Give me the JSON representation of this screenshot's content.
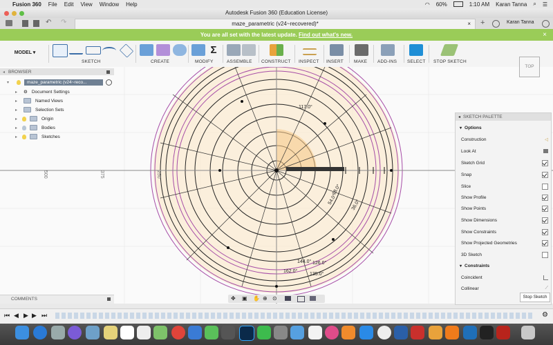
{
  "menubar": {
    "app_name": "Fusion 360",
    "items": [
      "File",
      "Edit",
      "View",
      "Window",
      "Help"
    ],
    "battery": "60%",
    "time": "1:10 AM",
    "user": "Karan Tanna"
  },
  "window": {
    "title": "Autodesk Fusion 360 (Education License)",
    "tab_title": "maze_parametric (v24~recovered)*",
    "account_name": "Karan Tanna"
  },
  "notification": {
    "text": "You are all set with the latest update.",
    "link": "Find out what's new."
  },
  "toolbar": {
    "workspace": "MODEL",
    "groups": [
      "SKETCH",
      "CREATE",
      "MODIFY",
      "ASSEMBLE",
      "CONSTRUCT",
      "INSPECT",
      "INSERT",
      "MAKE",
      "ADD-INS",
      "SELECT",
      "STOP SKETCH"
    ]
  },
  "browser": {
    "title": "BROWSER",
    "root": "maze_parametric (v24~reco...",
    "items": [
      "Document Settings",
      "Named Views",
      "Selection Sets",
      "Origin",
      "Bodies",
      "Sketches"
    ]
  },
  "canvas": {
    "ruler_labels": [
      "500",
      "375",
      "250"
    ],
    "sketch_labels": [
      "162.0°",
      "144.0°",
      "135.0°",
      "126.0°",
      "117.0°",
      "54.0°",
      "36.0°",
      "18.0°"
    ]
  },
  "viewcube": {
    "label": "TOP"
  },
  "palette": {
    "title": "SKETCH PALETTE",
    "options_header": "Options",
    "options": [
      {
        "label": "Construction",
        "checked": false
      },
      {
        "label": "Look At",
        "checked": false
      },
      {
        "label": "Sketch Grid",
        "checked": true
      },
      {
        "label": "Snap",
        "checked": true
      },
      {
        "label": "Slice",
        "checked": false
      },
      {
        "label": "Show Profile",
        "checked": true
      },
      {
        "label": "Show Points",
        "checked": true
      },
      {
        "label": "Show Dimensions",
        "checked": true
      },
      {
        "label": "Show Constraints",
        "checked": true
      },
      {
        "label": "Show Projected Geometries",
        "checked": true
      },
      {
        "label": "3D Sketch",
        "checked": false
      }
    ],
    "constraints_header": "Constraints",
    "constraints": [
      "Coincident",
      "Collinear"
    ],
    "stop_button": "Stop Sketch"
  },
  "comments": {
    "label": "COMMENTS"
  },
  "colors": {
    "notify": "#9acc58",
    "select_blue": "#1f8fd6",
    "sketch_purple": "#a64ca6",
    "profile_fill": "#fbe9cf"
  }
}
